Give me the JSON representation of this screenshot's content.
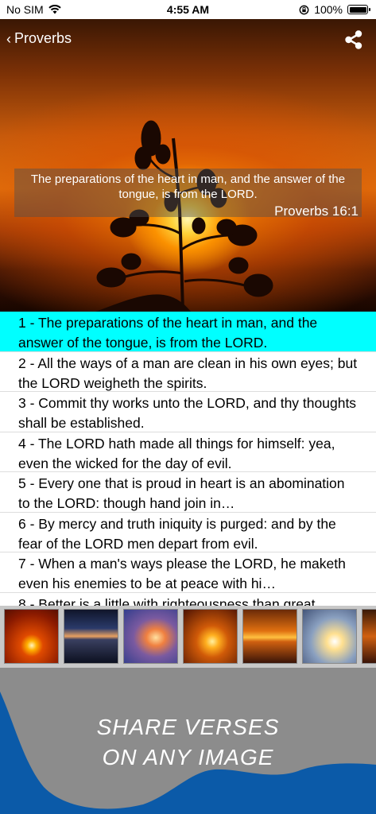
{
  "status": {
    "carrier": "No SIM",
    "time": "4:55 AM",
    "battery": "100%"
  },
  "nav": {
    "back_label": "Proverbs"
  },
  "hero": {
    "verse_text": "The preparations of the heart in man, and the answer of the tongue, is from the LORD.",
    "reference": "Proverbs 16:1"
  },
  "verses": [
    "1 - The preparations of the heart in man, and the answer of the tongue, is from the LORD.",
    "2 - All the ways of a man are clean in his own eyes; but the LORD weigheth the spirits.",
    "3 - Commit thy works unto the LORD, and thy thoughts shall be established.",
    "4 - The LORD hath made all things for himself: yea, even the wicked for the day of evil.",
    "5 - Every one that is proud in heart is an abomination to the LORD: though hand join in…",
    "6 - By mercy and truth iniquity is purged: and by the fear of the LORD men depart from evil.",
    "7 - When a man's ways please the LORD, he maketh even his enemies to be at peace with hi…",
    "8 - Better is a little with righteousness than great"
  ],
  "promo": {
    "line1": "SHARE VERSES",
    "line2": "ON ANY IMAGE"
  },
  "colors": {
    "selected_row": "#00ffff",
    "promo_blue": "#0b5aa8",
    "promo_gray": "#8c8c8c"
  }
}
